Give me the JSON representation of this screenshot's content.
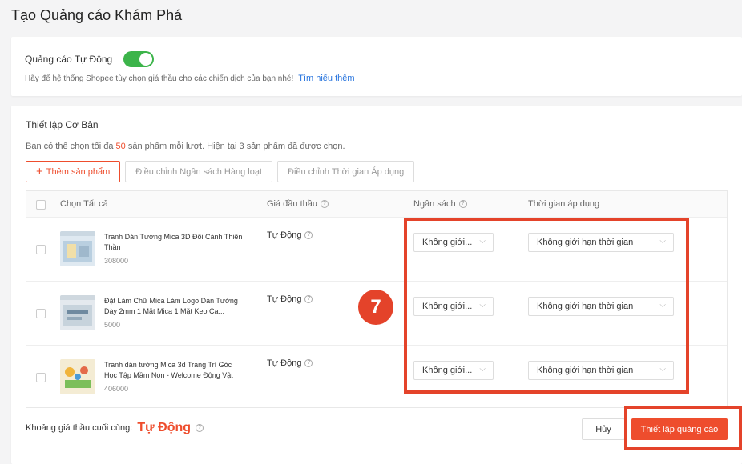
{
  "page": {
    "title": "Tạo Quảng cáo Khám Phá"
  },
  "auto_ads": {
    "label": "Quảng cáo Tự Động",
    "enabled": true,
    "description": "Hãy để hệ thống Shopee tùy chọn giá thầu cho các chiến dịch của bạn nhé!",
    "learn_more": "Tìm hiểu thêm"
  },
  "basic": {
    "title": "Thiết lập Cơ Bản",
    "desc_prefix": "Bạn có thể chọn tối đa",
    "desc_num": "50",
    "desc_suffix": "sản phẩm mỗi lượt. Hiện tại 3 sản phẩm đã được chọn.",
    "add_product": "Thêm sản phẩm",
    "adjust_budget": "Điều chỉnh Ngân sách Hàng loạt",
    "adjust_time": "Điều chỉnh Thời gian Áp dụng"
  },
  "table": {
    "headers": {
      "select_all": "Chọn Tất cả",
      "bid": "Giá đầu thầu",
      "budget": "Ngân sách",
      "time": "Thời gian áp dụng"
    },
    "rows": [
      {
        "name": "Tranh Dán Tường Mica 3D Đôi Cánh Thiên Thần",
        "id": "308000",
        "bid": "Tự Động",
        "budget": "Không giới...",
        "time": "Không giới hạn thời gian"
      },
      {
        "name": "Đặt Làm Chữ Mica Làm Logo Dán Tường Dày 2mm 1 Mặt Mica 1 Mặt Keo Ca...",
        "id": "5000",
        "bid": "Tự Động",
        "budget": "Không giới...",
        "time": "Không giới hạn thời gian"
      },
      {
        "name": "Tranh dán tường Mica 3d Trang Trí Góc Học Tập Mầm Non - Welcome Động Vật",
        "id": "406000",
        "bid": "Tự Động",
        "budget": "Không giới...",
        "time": "Không giới hạn thời gian"
      }
    ]
  },
  "footer": {
    "final_bid_label": "Khoảng giá thầu cuối cùng:",
    "final_bid_value": "Tự Động",
    "cancel": "Hủy",
    "submit": "Thiết lập quảng cáo"
  },
  "annotation": {
    "step": "7"
  },
  "colors": {
    "accent": "#ee4d2d",
    "toggle_on": "#3cb44a",
    "highlight": "#e4432a",
    "link": "#2673dd"
  }
}
